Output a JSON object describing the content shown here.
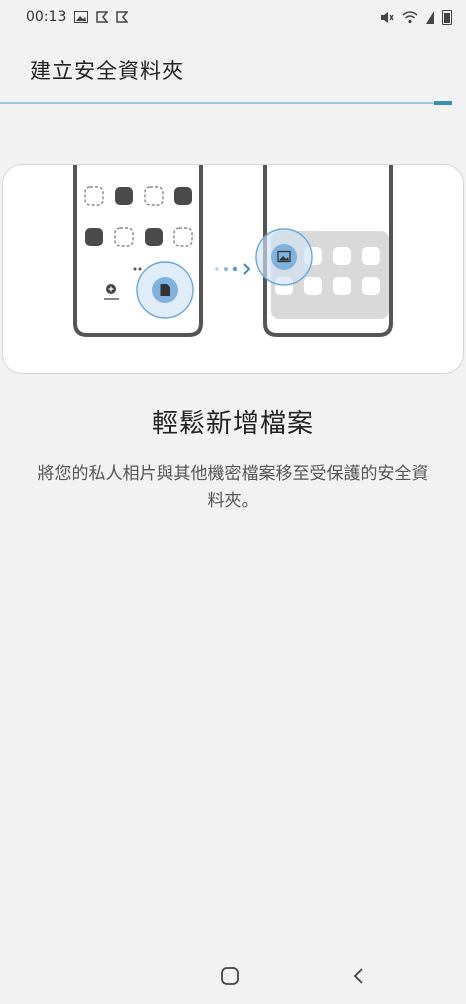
{
  "status_bar": {
    "time": "00:13",
    "left_icons": [
      "gallery-icon",
      "flag-icon",
      "flag-icon"
    ],
    "right_icons": [
      "mute-icon",
      "wifi-icon",
      "signal-icon",
      "battery-icon"
    ]
  },
  "header": {
    "title": "建立安全資料夾"
  },
  "progress": {
    "fraction": 0.97,
    "color": "#3d8fb0"
  },
  "content": {
    "headline": "輕鬆新增檔案",
    "description": "將您的私人相片與其他機密檔案移至受保護的安全資料夾。"
  },
  "nav": {
    "home_icon": "home-icon",
    "back_icon": "back-icon"
  },
  "colors": {
    "accent": "#3d8fb0",
    "bubble": "#cfe4f4",
    "bubble_border": "#6aa8d8",
    "app_icon_dark": "#4a4a4a"
  }
}
